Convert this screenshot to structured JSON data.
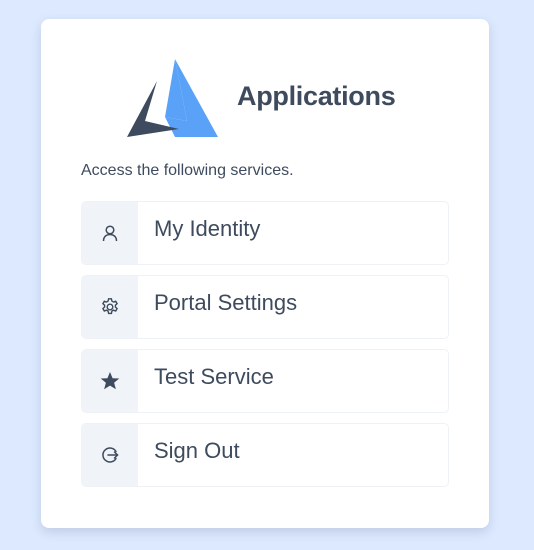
{
  "header": {
    "title": "Applications",
    "logo_icon": "triangle-logo-icon"
  },
  "intro": {
    "text": "Access the following services."
  },
  "menu": {
    "items": [
      {
        "label": "My Identity",
        "icon": "user-icon"
      },
      {
        "label": "Portal Settings",
        "icon": "gear-icon"
      },
      {
        "label": "Test Service",
        "icon": "star-icon"
      },
      {
        "label": "Sign Out",
        "icon": "sign-out-icon"
      }
    ]
  },
  "colors": {
    "background": "#dce9fe",
    "logo_blue": "#5aa2f8",
    "logo_dark": "#3e4b5e",
    "text": "#3e4b5e",
    "icon_box": "#f0f4f8"
  }
}
